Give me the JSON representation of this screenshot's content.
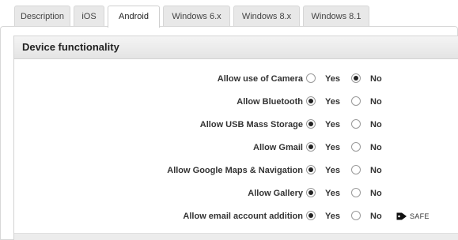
{
  "tabs": [
    {
      "label": "Description",
      "active": false
    },
    {
      "label": "iOS",
      "active": false
    },
    {
      "label": "Android",
      "active": true
    },
    {
      "label": "Windows 6.x",
      "active": false
    },
    {
      "label": "Windows 8.x",
      "active": false
    },
    {
      "label": "Windows 8.1",
      "active": false
    }
  ],
  "section": {
    "title": "Device functionality"
  },
  "options": {
    "yes_label": "Yes",
    "no_label": "No"
  },
  "settings": [
    {
      "label": "Allow use of Camera",
      "value": "No"
    },
    {
      "label": "Allow Bluetooth",
      "value": "Yes"
    },
    {
      "label": "Allow USB Mass Storage",
      "value": "Yes"
    },
    {
      "label": "Allow Gmail",
      "value": "Yes"
    },
    {
      "label": "Allow Google Maps & Navigation",
      "value": "Yes"
    },
    {
      "label": "Allow Gallery",
      "value": "Yes"
    },
    {
      "label": "Allow email account addition",
      "value": "Yes",
      "badge": "SAFE"
    }
  ],
  "icons": {
    "tag": "tag-icon"
  },
  "colors": {
    "tab_inactive_bg": "#e8e8e8",
    "header_bg": "#e8e8e8",
    "radio_dot": "#222222"
  }
}
